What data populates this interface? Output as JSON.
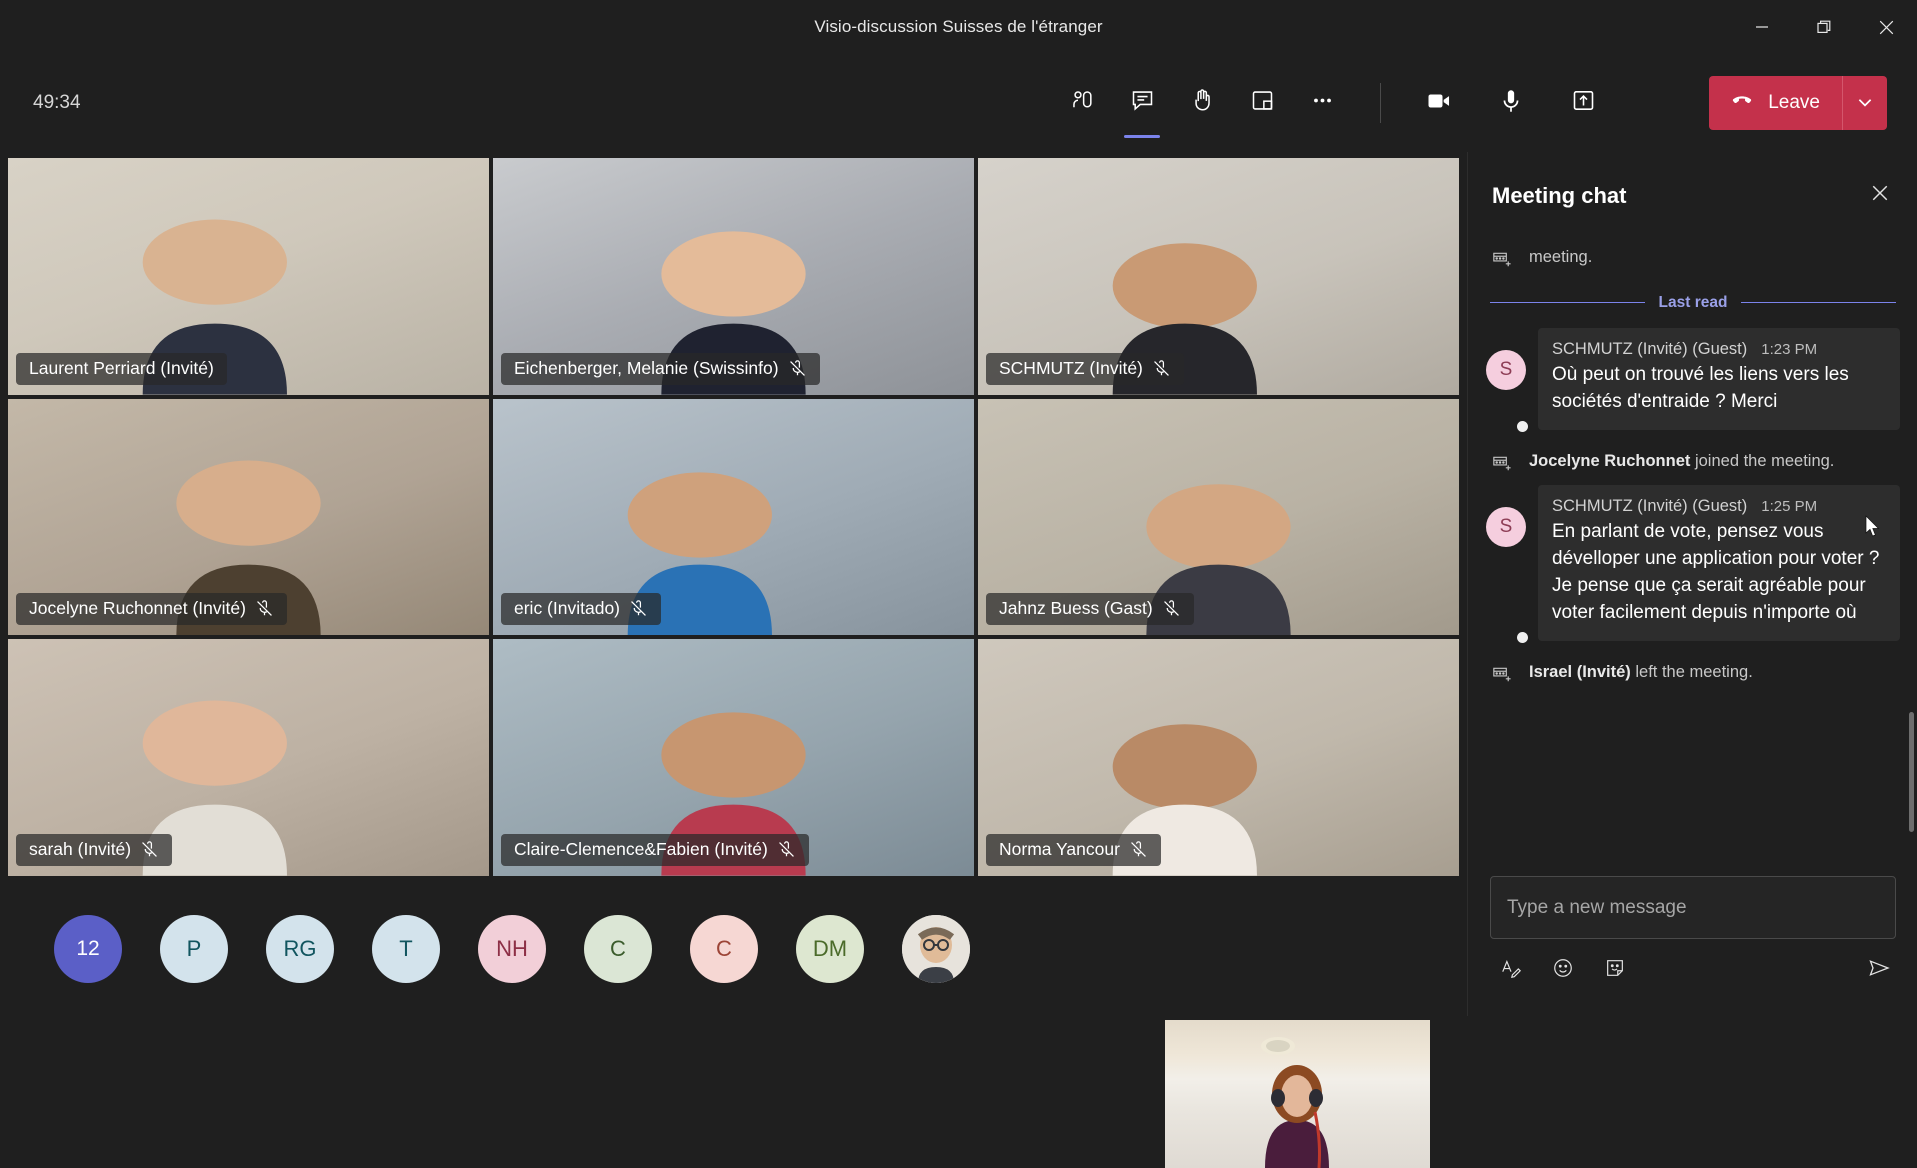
{
  "window": {
    "title": "Visio-discussion Suisses de l'étranger",
    "controls": [
      {
        "name": "minimize-button",
        "icon": "minimize-icon"
      },
      {
        "name": "restore-button",
        "icon": "restore-icon"
      },
      {
        "name": "close-button",
        "icon": "close-icon"
      }
    ]
  },
  "toolbar": {
    "timer": "49:34",
    "buttons": [
      {
        "name": "people-button",
        "icon": "people-icon",
        "label": "People",
        "active": false
      },
      {
        "name": "chat-button",
        "icon": "chat-icon",
        "label": "Meeting chat",
        "active": true
      },
      {
        "name": "raise-hand-button",
        "icon": "raise-hand-icon",
        "label": "Raise hand",
        "active": false
      },
      {
        "name": "rooms-button",
        "icon": "breakout-rooms-icon",
        "label": "Breakout rooms",
        "active": false
      },
      {
        "name": "more-actions-button",
        "icon": "more-ellipsis-icon",
        "label": "More actions",
        "active": false
      },
      {
        "name": "camera-button",
        "icon": "camera-icon",
        "label": "Camera",
        "active": false
      },
      {
        "name": "microphone-button",
        "icon": "microphone-icon",
        "label": "Mic",
        "active": false
      },
      {
        "name": "share-button",
        "icon": "share-screen-icon",
        "label": "Share",
        "active": false
      }
    ],
    "leave_label": "Leave",
    "leave_color": "#c4314b"
  },
  "stage": {
    "tiles": [
      {
        "name": "Laurent Perriard (Invité)",
        "muted": false,
        "bg": "#cfc6ba"
      },
      {
        "name": "Eichenberger, Melanie (Swissinfo)",
        "muted": true,
        "bg": "#b9bcc0"
      },
      {
        "name": "SCHMUTZ (Invité)",
        "muted": true,
        "bg": "#c9c6c0"
      },
      {
        "name": "Jocelyne Ruchonnet (Invité)",
        "muted": true,
        "bg": "#b6aa9c"
      },
      {
        "name": "eric (Invitado)",
        "muted": true,
        "bg": "#a9b4bd"
      },
      {
        "name": "Jahnz Buess (Gast)",
        "muted": true,
        "bg": "#b7b2a8"
      },
      {
        "name": "sarah (Invité)",
        "muted": true,
        "bg": "#bfb3a8"
      },
      {
        "name": "Claire-Clemence&Fabien (Invité)",
        "muted": true,
        "bg": "#9eadb4"
      },
      {
        "name": "Norma Yancour",
        "muted": true,
        "bg": "#c3bdb3"
      }
    ],
    "roster": [
      {
        "name": "overflow-count-avatar",
        "initials": "12",
        "type": "count",
        "bg": "#5b5fc7",
        "fg": "#ffffff"
      },
      {
        "name": "participant-avatar-p",
        "initials": "P",
        "type": "initials",
        "bg": "#d3e3ec",
        "fg": "#11555f"
      },
      {
        "name": "participant-avatar-rg",
        "initials": "RG",
        "type": "initials",
        "bg": "#d3e3ec",
        "fg": "#11555f"
      },
      {
        "name": "participant-avatar-t",
        "initials": "T",
        "type": "initials",
        "bg": "#d3e3ec",
        "fg": "#11555f"
      },
      {
        "name": "participant-avatar-nh",
        "initials": "NH",
        "type": "initials",
        "bg": "#f2cfd8",
        "fg": "#8d2f46"
      },
      {
        "name": "participant-avatar-c1",
        "initials": "C",
        "type": "initials",
        "bg": "#dbe6d5",
        "fg": "#3b5c2c"
      },
      {
        "name": "participant-avatar-c2",
        "initials": "C",
        "type": "initials",
        "bg": "#f6d7d3",
        "fg": "#9c4436"
      },
      {
        "name": "participant-avatar-dm",
        "initials": "DM",
        "type": "initials",
        "bg": "#dde7d0",
        "fg": "#4b6b2a"
      },
      {
        "name": "participant-avatar-photo",
        "initials": "",
        "type": "photo",
        "bg": "#cfcfcf",
        "fg": "#333333"
      }
    ],
    "selfview_label": ""
  },
  "chat": {
    "title": "Meeting chat",
    "close_icon": "close-icon",
    "last_read_label": "Last read",
    "items": [
      {
        "kind": "system",
        "name": "system-message",
        "icon": "calendar-add-icon",
        "who": "",
        "text": "meeting."
      },
      {
        "kind": "divider",
        "name": "last-read-divider",
        "label": "Last read"
      },
      {
        "kind": "message",
        "name": "chat-message",
        "avatar_initial": "S",
        "sender": "SCHMUTZ (Invité) (Guest)",
        "time": "1:23 PM",
        "text": "Où peut on trouvé les liens vers les sociétés d'entraide ? Merci"
      },
      {
        "kind": "system",
        "name": "system-message",
        "icon": "calendar-add-icon",
        "who": "Jocelyne Ruchonnet",
        "text": " joined the meeting."
      },
      {
        "kind": "message",
        "name": "chat-message",
        "avatar_initial": "S",
        "sender": "SCHMUTZ (Invité) (Guest)",
        "time": "1:25 PM",
        "text": "En parlant de vote, pensez vous dévelloper une application pour voter ? Je pense que ça serait agréable pour voter facilement depuis n'importe où"
      },
      {
        "kind": "system",
        "name": "system-message",
        "icon": "calendar-add-icon",
        "who": "Israel (Invité)",
        "text": " left the meeting."
      }
    ],
    "compose": {
      "placeholder": "Type a new message",
      "value": "",
      "actions": [
        {
          "name": "format-button",
          "icon": "format-text-icon"
        },
        {
          "name": "emoji-button",
          "icon": "emoji-icon"
        },
        {
          "name": "sticker-button",
          "icon": "sticker-icon"
        }
      ],
      "send": {
        "name": "send-button",
        "icon": "send-icon"
      }
    }
  }
}
